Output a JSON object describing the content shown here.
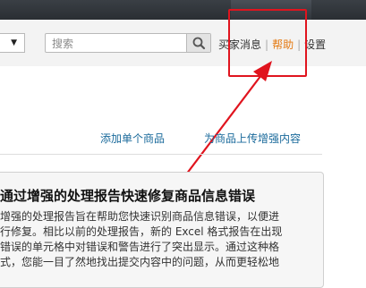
{
  "header": {
    "category_select_value": "",
    "search_placeholder": "搜索",
    "links": {
      "buyer_messages": "买家消息",
      "help": "帮助",
      "settings": "设置",
      "separator": "|"
    }
  },
  "actions": {
    "add_single_product": "添加单个商品",
    "upload_enhanced_content": "为商品上传增强内容"
  },
  "panel": {
    "title": "通过增强的处理报告快速修复商品信息错误",
    "lines": [
      "增强的处理报告旨在帮助您快速识别商品信息错误，以便进",
      "行修复。相比以前的处理报告，新的 Excel 格式报告在出现",
      "错误的单元格中对错误和警告进行了突出显示。通过这种格",
      "式，您能一目了然地找出提交内容中的问题，从而更轻松地"
    ]
  },
  "annotation": {
    "highlight_color": "#e0141e"
  },
  "colors": {
    "help_link": "#e47911",
    "action_link": "#1a6a9b"
  }
}
